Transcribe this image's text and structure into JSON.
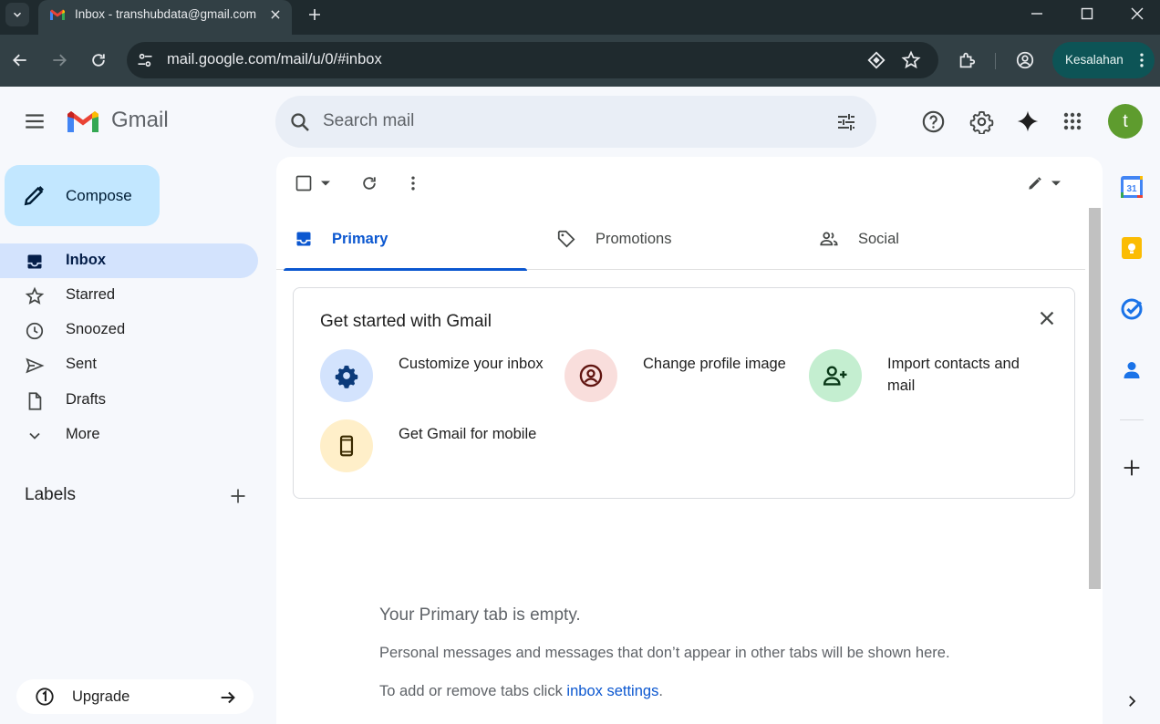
{
  "browser": {
    "tab_title": "Inbox - transhubdata@gmail.com - Gmail",
    "url": "mail.google.com/mail/u/0/#inbox",
    "profile_label": "Kesalahan"
  },
  "gmail": {
    "product_name": "Gmail",
    "search_placeholder": "Search mail",
    "avatar_initial": "t",
    "compose_label": "Compose",
    "nav": [
      {
        "label": "Inbox",
        "icon": "inbox-icon",
        "active": true
      },
      {
        "label": "Starred",
        "icon": "star-icon"
      },
      {
        "label": "Snoozed",
        "icon": "clock-icon"
      },
      {
        "label": "Sent",
        "icon": "send-icon"
      },
      {
        "label": "Drafts",
        "icon": "draft-icon"
      },
      {
        "label": "More",
        "icon": "chevron-down-icon"
      }
    ],
    "labels_title": "Labels",
    "upgrade_label": "Upgrade",
    "tabs": [
      {
        "label": "Primary",
        "icon": "inbox-icon",
        "active": true
      },
      {
        "label": "Promotions",
        "icon": "tag-icon"
      },
      {
        "label": "Social",
        "icon": "people-icon"
      }
    ],
    "get_started": {
      "title": "Get started with Gmail",
      "items": [
        {
          "label": "Customize your inbox",
          "icon": "gear-icon",
          "color": "#d3e3fd"
        },
        {
          "label": "Change profile image",
          "icon": "account-circle-icon",
          "color": "#f9dedc"
        },
        {
          "label": "Import contacts and mail",
          "icon": "person-add-icon",
          "color": "#c4eed0"
        },
        {
          "label": "Get Gmail for mobile",
          "icon": "phone-icon",
          "color": "#ffefc9"
        }
      ]
    },
    "empty_state": {
      "title": "Your Primary tab is empty.",
      "description": "Personal messages and messages that don’t appear in other tabs will be shown here.",
      "settings_prefix": "To add or remove tabs click ",
      "settings_link": "inbox settings",
      "settings_suffix": "."
    },
    "calendar_day": "31"
  },
  "colors": {
    "accent": "#0b57d0",
    "compose_bg": "#c2e7ff",
    "active_nav_bg": "#d3e3fd",
    "avatar_bg": "#5e9c2e",
    "profile_chip": "#0d5456"
  }
}
